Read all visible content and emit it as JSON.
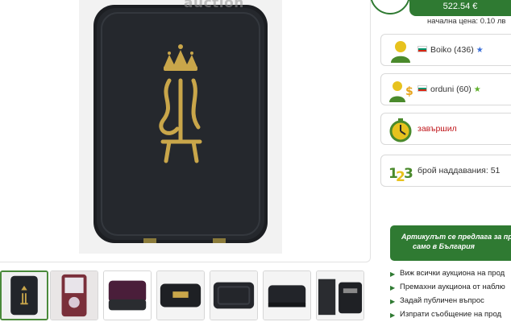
{
  "main_image": {
    "watermark": "auction"
  },
  "price": {
    "current": "522.54 €",
    "start_label": "начална цена: 0.10 лв"
  },
  "seller": {
    "name": "Boiko (436)",
    "icon": "user-icon"
  },
  "buyer": {
    "name": "orduni (60)",
    "icon": "buyer-money-icon"
  },
  "status": {
    "text": "завършил",
    "icon": "stopwatch-icon"
  },
  "bids": {
    "text": "брой наддавания: 51",
    "icon": "numbers-123-icon"
  },
  "shipping_notice": {
    "line1": "Артикулът се предлага за пр",
    "line2": "само в България"
  },
  "links": [
    "Виж всички аукциона на прод",
    "Премахни аукциона от наблю",
    "Задай публичен въпрос",
    "Изпрати съобщение на прод"
  ],
  "thumbnails": [
    "thumb-1",
    "thumb-2",
    "thumb-3",
    "thumb-4",
    "thumb-5",
    "thumb-6",
    "thumb-7"
  ],
  "colors": {
    "accent_green": "#2f7a32",
    "status_red": "#c0171c"
  }
}
